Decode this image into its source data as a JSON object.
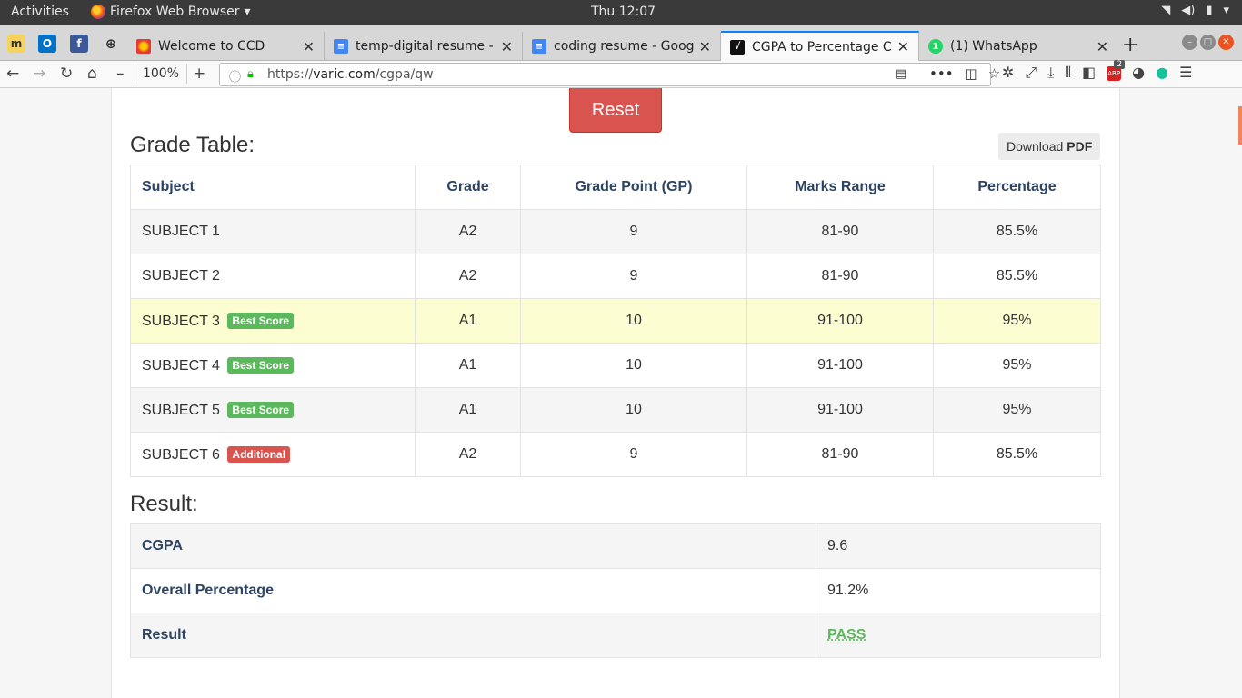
{
  "system": {
    "activities": "Activities",
    "app_name": "Firefox Web Browser",
    "clock": "Thu 12:07"
  },
  "browser": {
    "tabs": [
      {
        "label": "Welcome to CCD",
        "icon": "ccd-icon",
        "active": false
      },
      {
        "label": "temp-digital resume - G",
        "icon": "google-docs-icon",
        "active": false
      },
      {
        "label": "coding resume - Google",
        "icon": "google-docs-icon",
        "active": false
      },
      {
        "label": "CGPA to Percentage Ca",
        "icon": "varic-icon",
        "active": true
      },
      {
        "label": "(1) WhatsApp",
        "icon": "whatsapp-icon",
        "active": false
      }
    ],
    "zoom": "100%",
    "url_prefix": "https://",
    "url_host": "varic.com",
    "url_path": "/cgpa/qw",
    "abp_badge": "2",
    "abp_label": "ABP"
  },
  "page": {
    "reset_label": "Reset",
    "grade_table_heading": "Grade Table:",
    "download_label": "Download",
    "download_format": "PDF",
    "columns": [
      "Subject",
      "Grade",
      "Grade Point (GP)",
      "Marks Range",
      "Percentage"
    ],
    "rows": [
      {
        "subject": "SUBJECT 1",
        "badge": "",
        "grade": "A2",
        "gp": "9",
        "range": "81-90",
        "pct": "85.5%"
      },
      {
        "subject": "SUBJECT 2",
        "badge": "",
        "grade": "A2",
        "gp": "9",
        "range": "81-90",
        "pct": "85.5%"
      },
      {
        "subject": "SUBJECT 3",
        "badge": "Best Score",
        "grade": "A1",
        "gp": "10",
        "range": "91-100",
        "pct": "95%"
      },
      {
        "subject": "SUBJECT 4",
        "badge": "Best Score",
        "grade": "A1",
        "gp": "10",
        "range": "91-100",
        "pct": "95%"
      },
      {
        "subject": "SUBJECT 5",
        "badge": "Best Score",
        "grade": "A1",
        "gp": "10",
        "range": "91-100",
        "pct": "95%"
      },
      {
        "subject": "SUBJECT 6",
        "badge": "Additional",
        "grade": "A2",
        "gp": "9",
        "range": "81-90",
        "pct": "85.5%"
      }
    ],
    "result_heading": "Result:",
    "result": {
      "cgpa_label": "CGPA",
      "cgpa_value": "9.6",
      "percentage_label": "Overall Percentage",
      "percentage_value": "91.2%",
      "result_label": "Result",
      "result_value": "PASS"
    },
    "colors": {
      "reset_button": "#d9534f",
      "best_score_badge": "#5cb85c",
      "additional_badge": "#d9534f",
      "highlight_row": "#fcfdd0",
      "pass_text": "#5cb85c",
      "header_text": "#2c4361"
    }
  }
}
